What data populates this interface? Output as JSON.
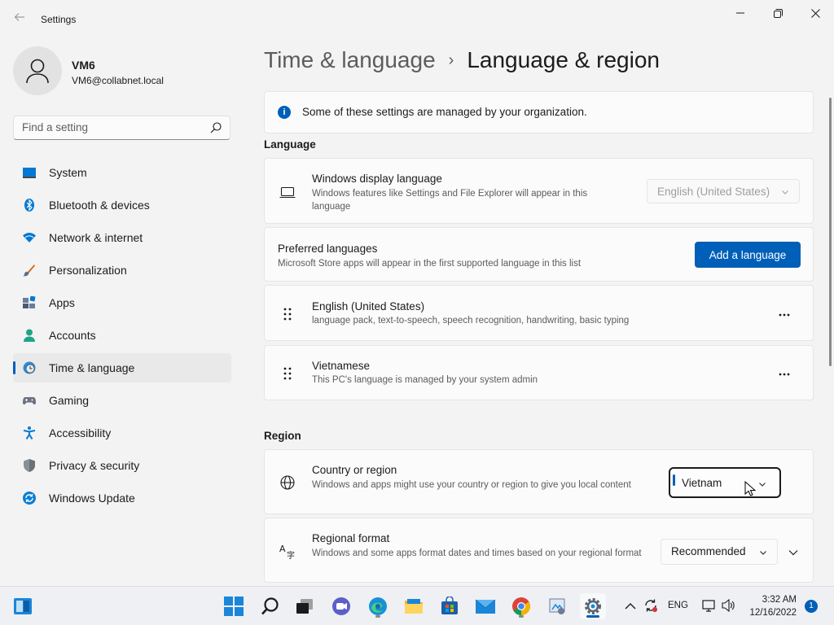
{
  "window": {
    "title": "Settings",
    "back_icon": "back-arrow-icon",
    "controls": [
      "minimize-icon",
      "maximize-icon",
      "close-icon"
    ]
  },
  "profile": {
    "name": "VM6",
    "email": "VM6@collabnet.local"
  },
  "search": {
    "placeholder": "Find a setting"
  },
  "sidebar": {
    "items": [
      {
        "label": "System",
        "icon": "system-icon",
        "active": false
      },
      {
        "label": "Bluetooth & devices",
        "icon": "bluetooth-icon",
        "active": false
      },
      {
        "label": "Network & internet",
        "icon": "wifi-icon",
        "active": false
      },
      {
        "label": "Personalization",
        "icon": "brush-icon",
        "active": false
      },
      {
        "label": "Apps",
        "icon": "apps-icon",
        "active": false
      },
      {
        "label": "Accounts",
        "icon": "person-icon",
        "active": false
      },
      {
        "label": "Time & language",
        "icon": "globe-clock-icon",
        "active": true
      },
      {
        "label": "Gaming",
        "icon": "gamepad-icon",
        "active": false
      },
      {
        "label": "Accessibility",
        "icon": "accessibility-icon",
        "active": false
      },
      {
        "label": "Privacy & security",
        "icon": "shield-icon",
        "active": false
      },
      {
        "label": "Windows Update",
        "icon": "update-icon",
        "active": false
      }
    ]
  },
  "main": {
    "breadcrumb": {
      "parent": "Time & language",
      "separator": "›",
      "current": "Language & region"
    },
    "info_banner": "Some of these settings are managed by your organization.",
    "language_section": {
      "label": "Language",
      "display_language": {
        "title": "Windows display language",
        "desc": "Windows features like Settings and File Explorer will appear in this language",
        "value": "English (United States)"
      },
      "preferred": {
        "title": "Preferred languages",
        "desc": "Microsoft Store apps will appear in the first supported language in this list",
        "button": "Add a language"
      },
      "languages": [
        {
          "name": "English (United States)",
          "desc": "language pack, text-to-speech, speech recognition, handwriting, basic typing"
        },
        {
          "name": "Vietnamese",
          "desc": "This PC's language is managed by your system admin"
        }
      ]
    },
    "region_section": {
      "label": "Region",
      "country": {
        "title": "Country or region",
        "desc": "Windows and apps might use your country or region to give you local content",
        "value": "Vietnam"
      },
      "format": {
        "title": "Regional format",
        "desc": "Windows and some apps format dates and times based on your regional format",
        "value": "Recommended"
      }
    }
  },
  "taskbar": {
    "apps": [
      "widgets-icon",
      "start-icon",
      "search-icon",
      "task-view-icon",
      "teams-chat-icon",
      "edge-icon",
      "file-explorer-icon",
      "store-icon",
      "mail-icon",
      "chrome-icon",
      "control-panel-icon",
      "settings-icon"
    ],
    "tray": {
      "language": "ENG",
      "time": "3:32 AM",
      "date": "12/16/2022",
      "notifications": "1"
    }
  },
  "colors": {
    "accent": "#005fb8",
    "background": "#f3f3f3",
    "card": "#fbfbfb"
  }
}
